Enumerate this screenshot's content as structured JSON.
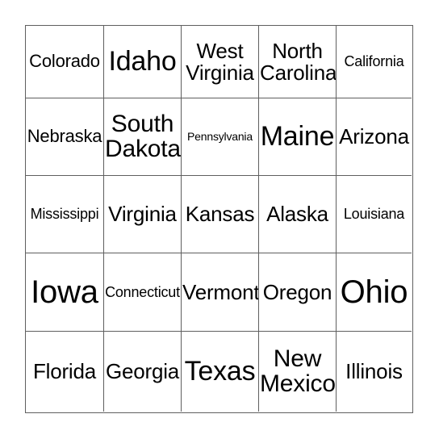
{
  "card": {
    "type": "bingo-card",
    "rows": 5,
    "columns": 5,
    "background_color": "#ffffff",
    "border_color": "#5f5f5f",
    "text_color": "#000000",
    "cells": [
      {
        "label": "Colorado",
        "size": "s-sm",
        "lines": 1
      },
      {
        "label": "Idaho",
        "size": "s-xl",
        "lines": 1
      },
      {
        "label": "West\nVirginia",
        "size": "s-md",
        "lines": 2
      },
      {
        "label": "North\nCarolina",
        "size": "s-md",
        "lines": 2
      },
      {
        "label": "California",
        "size": "s-xs",
        "lines": 1
      },
      {
        "label": "Nebraska",
        "size": "s-sm",
        "lines": 1
      },
      {
        "label": "South\nDakota",
        "size": "s-lg",
        "lines": 2
      },
      {
        "label": "Pennsylvania",
        "size": "s-xxs",
        "lines": 1
      },
      {
        "label": "Maine",
        "size": "s-xl",
        "lines": 1
      },
      {
        "label": "Arizona",
        "size": "s-md",
        "lines": 1
      },
      {
        "label": "Mississippi",
        "size": "s-xs",
        "lines": 1
      },
      {
        "label": "Virginia",
        "size": "s-md",
        "lines": 1
      },
      {
        "label": "Kansas",
        "size": "s-md",
        "lines": 1
      },
      {
        "label": "Alaska",
        "size": "s-md",
        "lines": 1
      },
      {
        "label": "Louisiana",
        "size": "s-xs",
        "lines": 1
      },
      {
        "label": "Iowa",
        "size": "s-xxl",
        "lines": 1
      },
      {
        "label": "Connecticut",
        "size": "s-xs",
        "lines": 1
      },
      {
        "label": "Vermont",
        "size": "s-md",
        "lines": 1
      },
      {
        "label": "Oregon",
        "size": "s-md",
        "lines": 1
      },
      {
        "label": "Ohio",
        "size": "s-xxl",
        "lines": 1
      },
      {
        "label": "Florida",
        "size": "s-md",
        "lines": 1
      },
      {
        "label": "Georgia",
        "size": "s-md",
        "lines": 1
      },
      {
        "label": "Texas",
        "size": "s-xl",
        "lines": 1
      },
      {
        "label": "New\nMexico",
        "size": "s-lg",
        "lines": 2
      },
      {
        "label": "Illinois",
        "size": "s-md",
        "lines": 1
      }
    ]
  }
}
